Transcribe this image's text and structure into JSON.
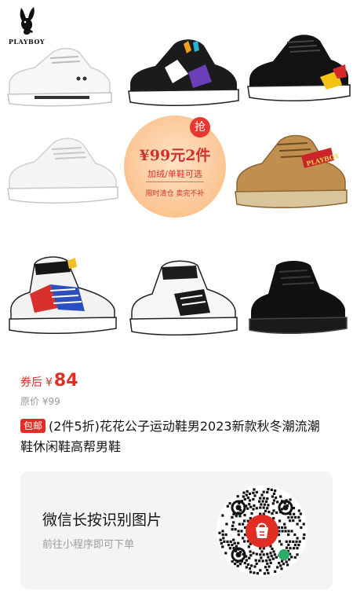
{
  "brand": {
    "logo_text": "PLAYBOY"
  },
  "promo": {
    "badge": "抢",
    "main": "¥99元2件",
    "sub": "加绒/单鞋可选",
    "note": "限时清仓 卖完不补",
    "accent": "#d0312c"
  },
  "shoes": [
    {
      "name": "white-casual-sneaker",
      "color": "#f5f5f5"
    },
    {
      "name": "black-sport-sneaker-multicolor",
      "color": "#1c1c1c"
    },
    {
      "name": "black-knit-runner-yellow-sole",
      "color": "#111111"
    },
    {
      "name": "white-mesh-sneaker",
      "color": "#f2f2f2"
    },
    {
      "name": "tan-work-boot-red-label",
      "color": "#c1904f",
      "label": "PLAYBOY"
    },
    {
      "name": "high-top-blue-red-white",
      "color": "#2b4fc0"
    },
    {
      "name": "high-top-white-black-graphic",
      "color": "#f6f6f6"
    },
    {
      "name": "black-leather-high-top",
      "color": "#0d0d0d"
    }
  ],
  "price": {
    "label": "券后",
    "symbol": "¥",
    "value": "84",
    "original": "原价 ¥99",
    "color": "#e02e24"
  },
  "title": {
    "tag": "包邮",
    "text": "(2件5折)花花公子运动鞋男2023新款秋冬潮流潮鞋休闲鞋高帮男鞋"
  },
  "qr": {
    "title": "微信长按识别图片",
    "subtitle": "前往小程序即可下单",
    "center_icon": "pinduoduo-icon"
  }
}
